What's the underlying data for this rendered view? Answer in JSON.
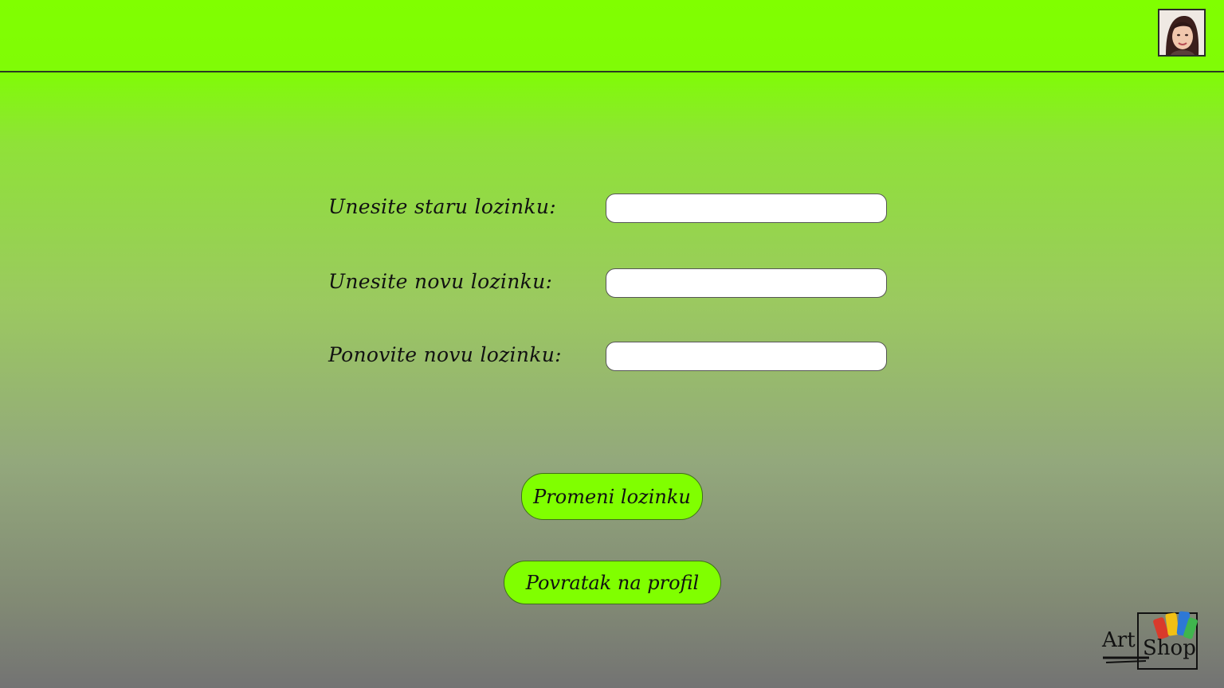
{
  "header": {
    "avatar_icon": "user-avatar-photo"
  },
  "form": {
    "old_password_label": "Unesite staru lozinku:",
    "old_password_value": "",
    "new_password_label": "Unesite novu lozinku:",
    "new_password_value": "",
    "repeat_password_label": "Ponovite novu lozinku:",
    "repeat_password_value": ""
  },
  "actions": {
    "change_password_label": "Promeni lozinku",
    "back_to_profile_label": "Povratak na profil"
  },
  "logo": {
    "word1": "Art",
    "word2": "Shop"
  },
  "colors": {
    "accent": "#80ff00",
    "gradient_bottom": "#737373"
  }
}
